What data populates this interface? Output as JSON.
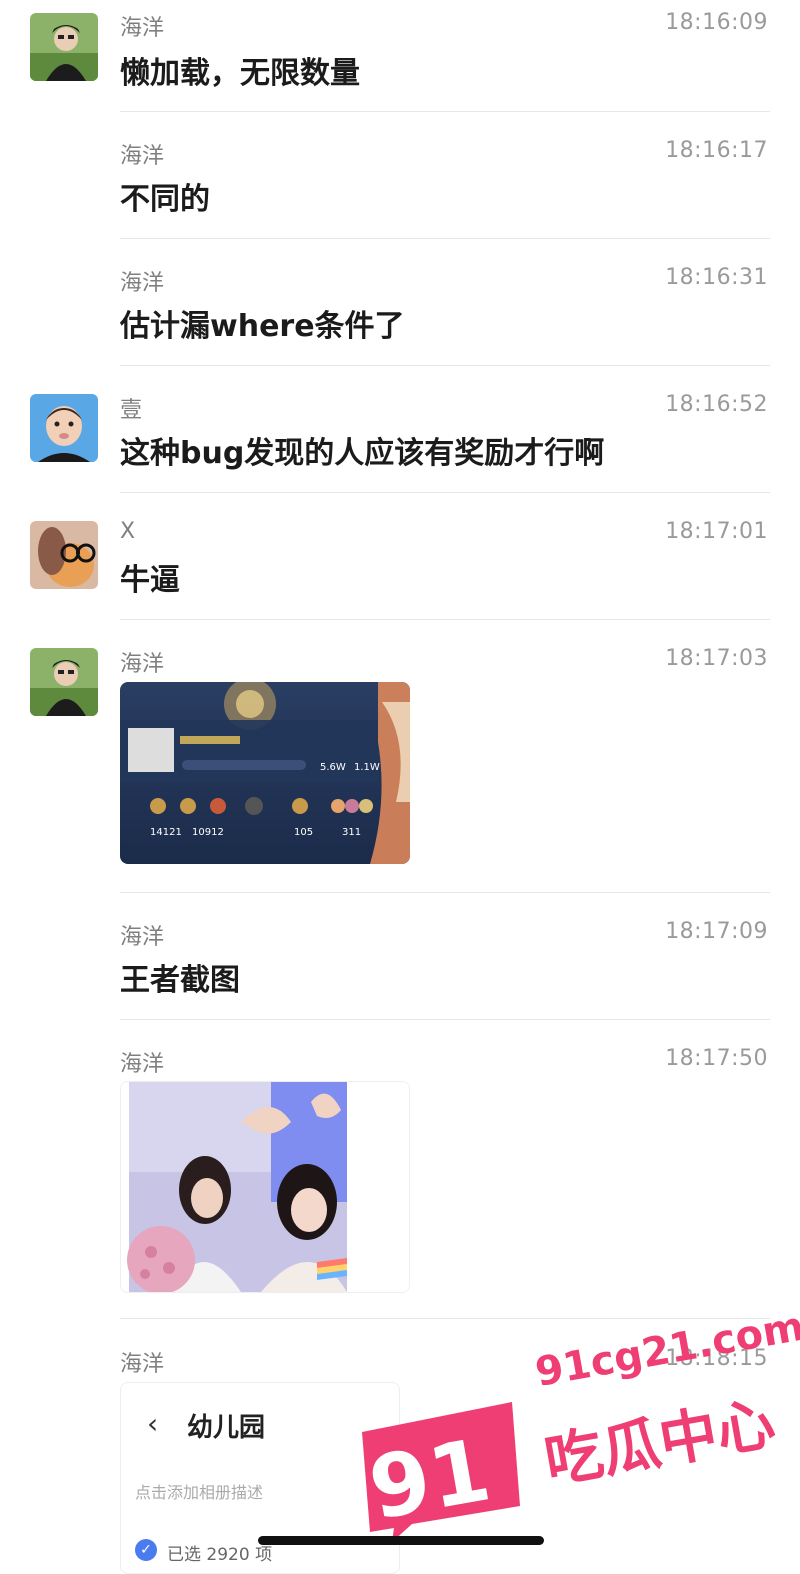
{
  "messages": [
    {
      "sender": "海洋",
      "time": "18:16:09",
      "text": "懒加载，无限数量"
    },
    {
      "sender": "海洋",
      "time": "18:16:17",
      "text": "不同的"
    },
    {
      "sender": "海洋",
      "time": "18:16:31",
      "text": "估计漏where条件了"
    },
    {
      "sender": "壹",
      "time": "18:16:52",
      "text": "这种bug发现的人应该有奖励才行啊"
    },
    {
      "sender": "X",
      "time": "18:17:01",
      "text": "牛逼"
    },
    {
      "sender": "海洋",
      "time": "18:17:03"
    },
    {
      "sender": "海洋",
      "time": "18:17:09",
      "text": "王者截图"
    },
    {
      "sender": "海洋",
      "time": "18:17:50"
    },
    {
      "sender": "海洋",
      "time": "18:18:15"
    }
  ],
  "game_screenshot": {
    "likes": "5.6W",
    "thumbs": "1.1W",
    "stats": [
      "14121",
      "10912",
      "105",
      "311"
    ]
  },
  "album_card": {
    "title": "幼儿园",
    "description_placeholder": "点击添加相册描述",
    "selected": "已选 2920 项"
  },
  "watermark": {
    "url": "91cg21.com",
    "brand": "吃瓜中心",
    "number": "91"
  },
  "colors": {
    "accent_pink": "#ee3e73",
    "divider": "#e6e6e6",
    "check_blue": "#4a7cf0"
  }
}
